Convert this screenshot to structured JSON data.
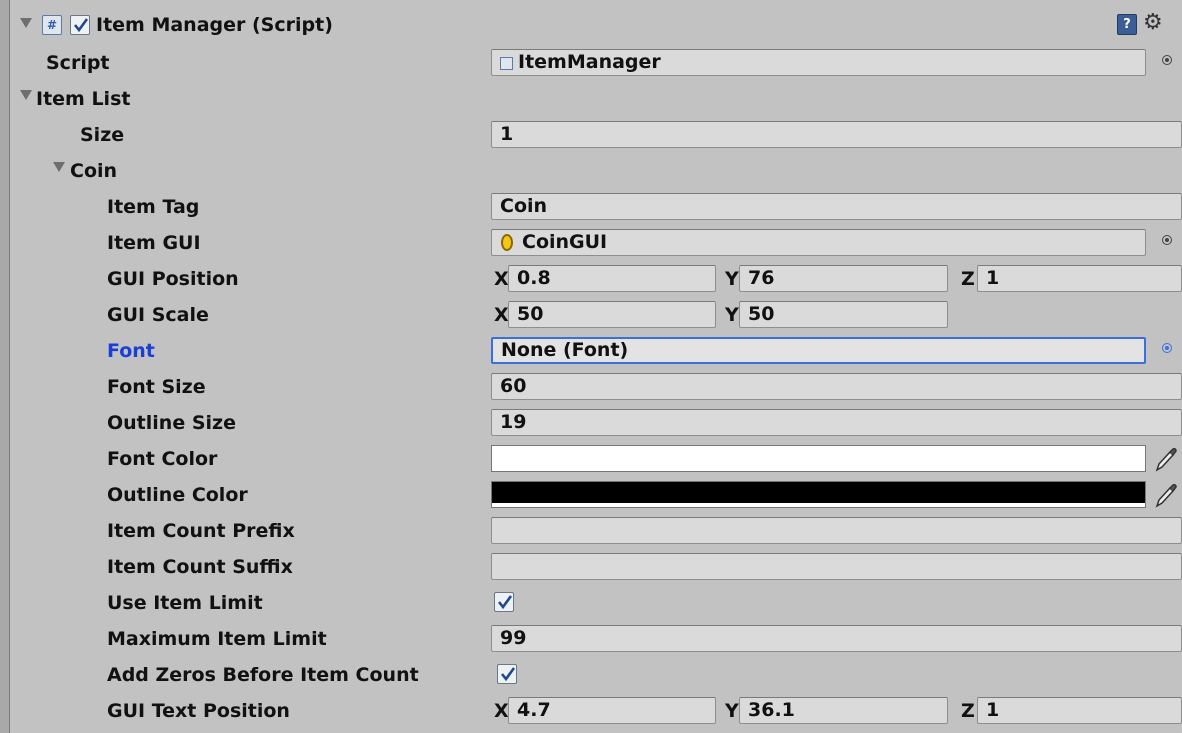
{
  "component": {
    "title": "Item Manager (Script)",
    "enabled": true,
    "icons": [
      "script-cs-icon",
      "help-book-icon",
      "gear-icon"
    ]
  },
  "script": {
    "label": "Script",
    "value": "ItemManager"
  },
  "item_list": {
    "label": "Item List",
    "size_label": "Size",
    "size_value": "1",
    "element": {
      "label": "Coin",
      "item_tag": {
        "label": "Item Tag",
        "value": "Coin"
      },
      "item_gui": {
        "label": "Item GUI",
        "value": "CoinGUI"
      },
      "gui_position": {
        "label": "GUI Position",
        "x": "0.8",
        "y": "76",
        "z": "1"
      },
      "gui_scale": {
        "label": "GUI Scale",
        "x": "50",
        "y": "50"
      },
      "font": {
        "label": "Font",
        "value": "None (Font)"
      },
      "font_size": {
        "label": "Font Size",
        "value": "60"
      },
      "outline_size": {
        "label": "Outline Size",
        "value": "19"
      },
      "font_color": {
        "label": "Font Color",
        "color": "#ffffff"
      },
      "outline_color": {
        "label": "Outline Color",
        "color": "#000000"
      },
      "item_count_prefix": {
        "label": "Item Count Prefix",
        "value": ""
      },
      "item_count_suffix": {
        "label": "Item Count Suffix",
        "value": ""
      },
      "use_item_limit": {
        "label": "Use Item Limit",
        "checked": true
      },
      "maximum_item_limit": {
        "label": "Maximum Item Limit",
        "value": "99"
      },
      "add_zeros": {
        "label": "Add Zeros Before Item Count",
        "checked": true
      },
      "gui_text_position": {
        "label": "GUI Text Position",
        "x": "4.7",
        "y": "36.1",
        "z": "1"
      }
    }
  },
  "axis_labels": {
    "x": "X",
    "y": "Y",
    "z": "Z"
  },
  "colors": {
    "focus": "#3b6fe0",
    "panel": "#c2c2c2",
    "field": "#dadada"
  }
}
